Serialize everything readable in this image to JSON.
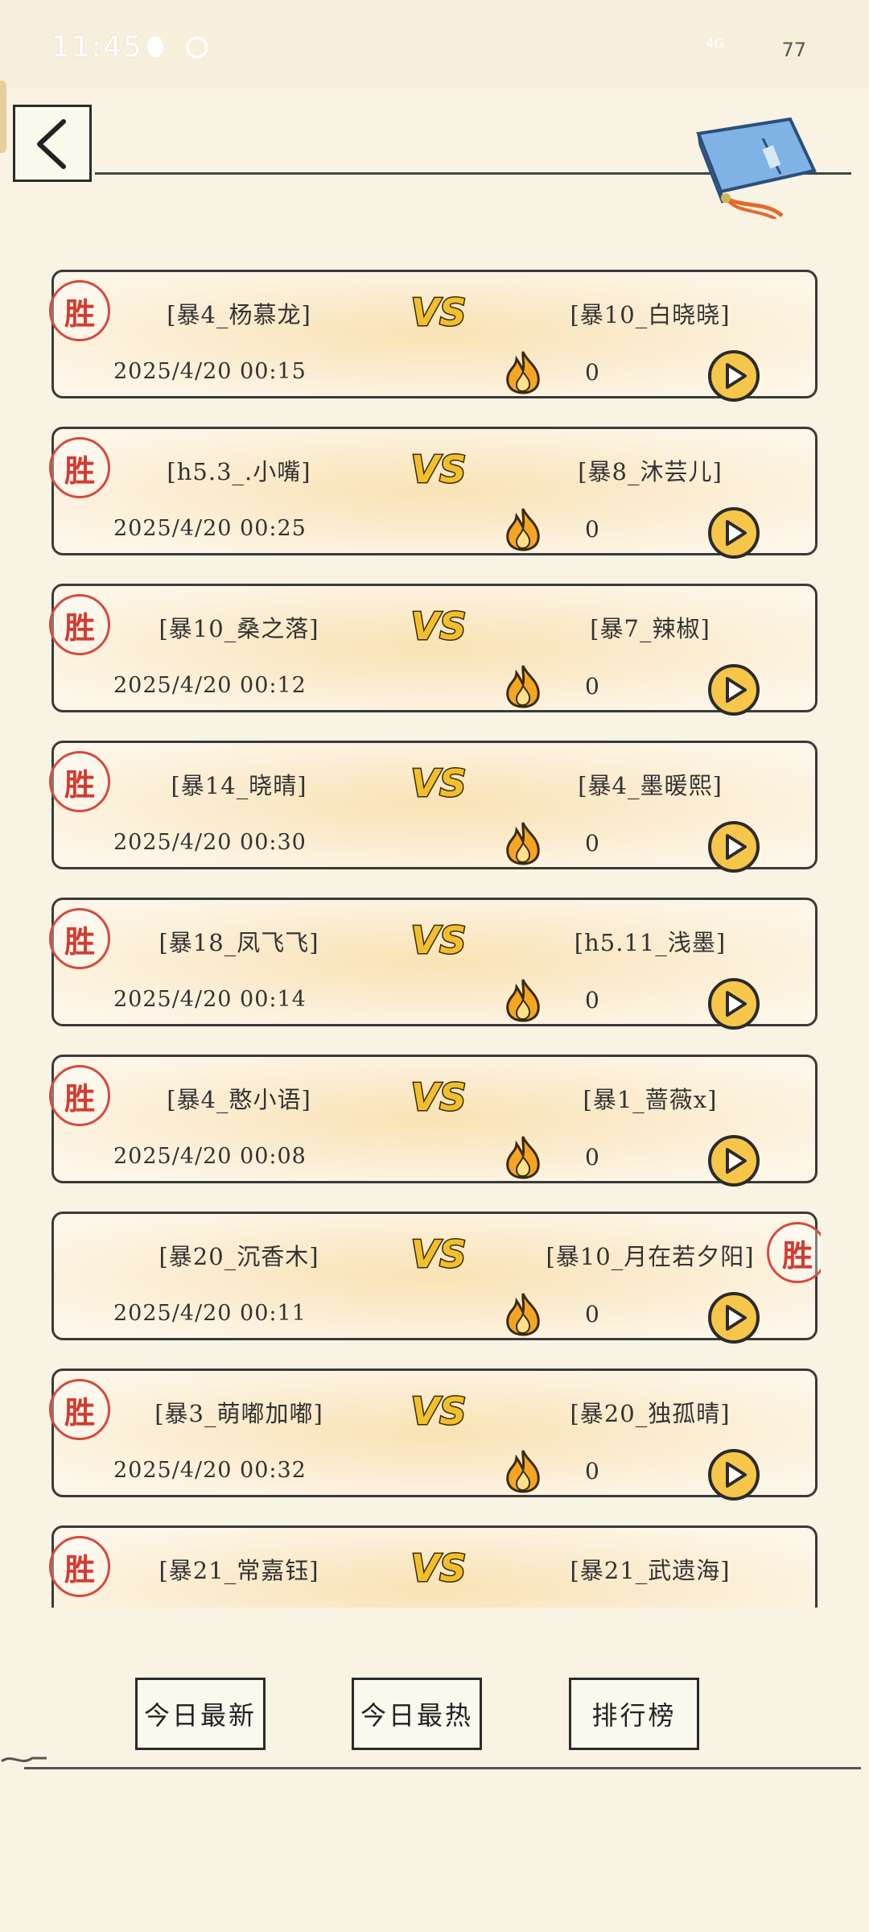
{
  "status_bar": {
    "time": "11:45",
    "network": "4G",
    "battery": "77"
  },
  "header": {
    "back_icon": "chevron-left-icon",
    "book_icon": "scroll-book-icon"
  },
  "win_stamp_text": "胜",
  "vs_text": "VS",
  "matches": [
    {
      "left": "[暴4_杨慕龙]",
      "right": "[暴10_白晓晓]",
      "date": "2025/4/20 00:15",
      "count": "0",
      "winner": "left"
    },
    {
      "left": "[h5.3_.小嘴]",
      "right": "[暴8_沐芸儿]",
      "date": "2025/4/20 00:25",
      "count": "0",
      "winner": "left"
    },
    {
      "left": "[暴10_桑之落]",
      "right": "[暴7_辣椒]",
      "date": "2025/4/20 00:12",
      "count": "0",
      "winner": "left"
    },
    {
      "left": "[暴14_晓晴]",
      "right": "[暴4_墨暖熙]",
      "date": "2025/4/20 00:30",
      "count": "0",
      "winner": "left"
    },
    {
      "left": "[暴18_凤飞飞]",
      "right": "[h5.11_浅墨]",
      "date": "2025/4/20 00:14",
      "count": "0",
      "winner": "left"
    },
    {
      "left": "[暴4_憨小语]",
      "right": "[暴1_蔷薇x]",
      "date": "2025/4/20 00:08",
      "count": "0",
      "winner": "left"
    },
    {
      "left": "[暴20_沉香木]",
      "right": "[暴10_月在若夕阳]",
      "date": "2025/4/20 00:11",
      "count": "0",
      "winner": "right"
    },
    {
      "left": "[暴3_萌嘟加嘟]",
      "right": "[暴20_独孤晴]",
      "date": "2025/4/20 00:32",
      "count": "0",
      "winner": "left"
    },
    {
      "left": "[暴21_常嘉钰]",
      "right": "[暴21_武遗海]",
      "date": "",
      "count": "",
      "winner": "left"
    }
  ],
  "nav": {
    "today_latest": "今日最新",
    "today_hottest": "今日最热",
    "leaderboard": "排行榜"
  }
}
